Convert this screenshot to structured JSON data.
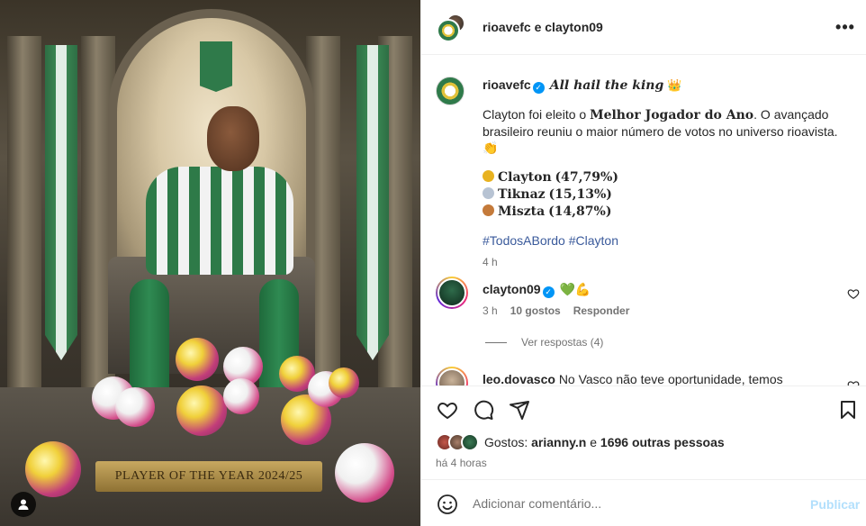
{
  "media": {
    "plaque_text": "PLAYER OF THE YEAR 2024/25",
    "icon": "person-tag-icon"
  },
  "header": {
    "title": "rioavefc e clayton09",
    "more_icon": "more-horizontal-icon"
  },
  "caption": {
    "username": "rioavefc",
    "headline": "All hail the king",
    "headline_emoji": "👑",
    "para_start": "Clayton foi eleito o ",
    "para_bold": "Melhor Jogador do Ano",
    "para_end": ". O avançado brasileiro reuniu o maior número de votos no universo rioavista. 👏",
    "ranking": [
      {
        "name": "Clayton",
        "pct": "(47,79%)",
        "medal": "gold"
      },
      {
        "name": "Tiknaz",
        "pct": "(15,13%)",
        "medal": "silver"
      },
      {
        "name": "Miszta",
        "pct": "(14,87%)",
        "medal": "bronze"
      }
    ],
    "hashtag1": "#TodosABordo",
    "hashtag2": "#Clayton",
    "time": "4 h"
  },
  "comments": [
    {
      "username": "clayton09",
      "text_emoji1": "💚",
      "text_emoji2": "💪",
      "time": "3 h",
      "likes": "10 gostos",
      "reply": "Responder",
      "view_replies": "Ver respostas (4)"
    },
    {
      "username": "leo.dovasco",
      "text": "No Vasco não teve oportunidade, temos"
    }
  ],
  "actions": {
    "likes_prefix": "Gostos: ",
    "likes_user": "arianny.n",
    "likes_and": " e ",
    "likes_others": "1696 outras pessoas",
    "posted": "há 4 horas"
  },
  "comment_box": {
    "placeholder": "Adicionar comentário...",
    "post_label": "Publicar"
  },
  "colors": {
    "accent": "#0095f6",
    "hashtag": "#3a5a9b",
    "muted": "#737373",
    "post_disabled": "#b2dffc"
  }
}
